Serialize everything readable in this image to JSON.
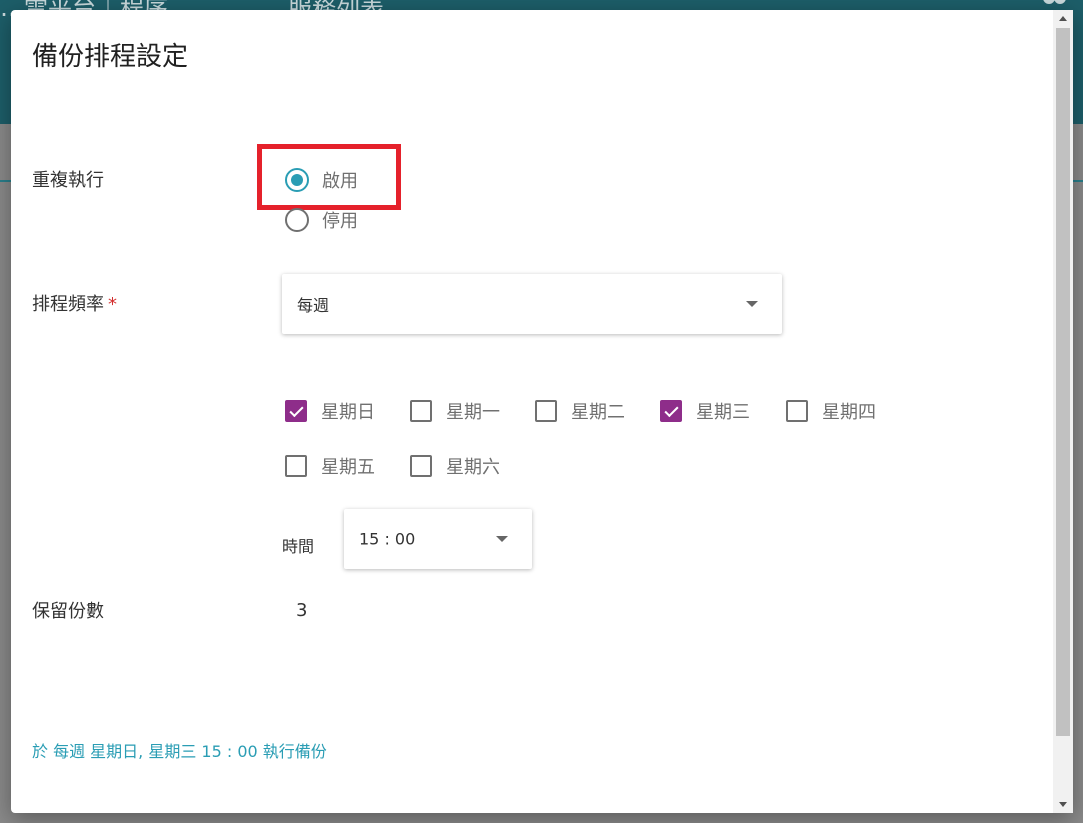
{
  "background": {
    "title": "…雲平台｜程序 ⌄",
    "menu": "服務列表 ⌄"
  },
  "dialog": {
    "title": "備份排程設定",
    "repeat": {
      "label": "重複執行",
      "options": [
        {
          "label": "啟用",
          "selected": true
        },
        {
          "label": "停用",
          "selected": false
        }
      ]
    },
    "frequency": {
      "label": "排程頻率",
      "required_mark": "*",
      "value": "每週"
    },
    "weekdays": [
      {
        "label": "星期日",
        "checked": true
      },
      {
        "label": "星期一",
        "checked": false
      },
      {
        "label": "星期二",
        "checked": false
      },
      {
        "label": "星期三",
        "checked": true
      },
      {
        "label": "星期四",
        "checked": false
      },
      {
        "label": "星期五",
        "checked": false
      },
      {
        "label": "星期六",
        "checked": false
      }
    ],
    "time": {
      "label": "時間",
      "value": "15 : 00"
    },
    "retention": {
      "label": "保留份數",
      "value": "3"
    },
    "summary": "於 每週 星期日, 星期三 15 : 00 執行備份"
  },
  "colors": {
    "accent": "#2a9db4",
    "checkbox": "#8e2d8a",
    "highlight": "#e5212b",
    "header": "#1d5e69"
  }
}
